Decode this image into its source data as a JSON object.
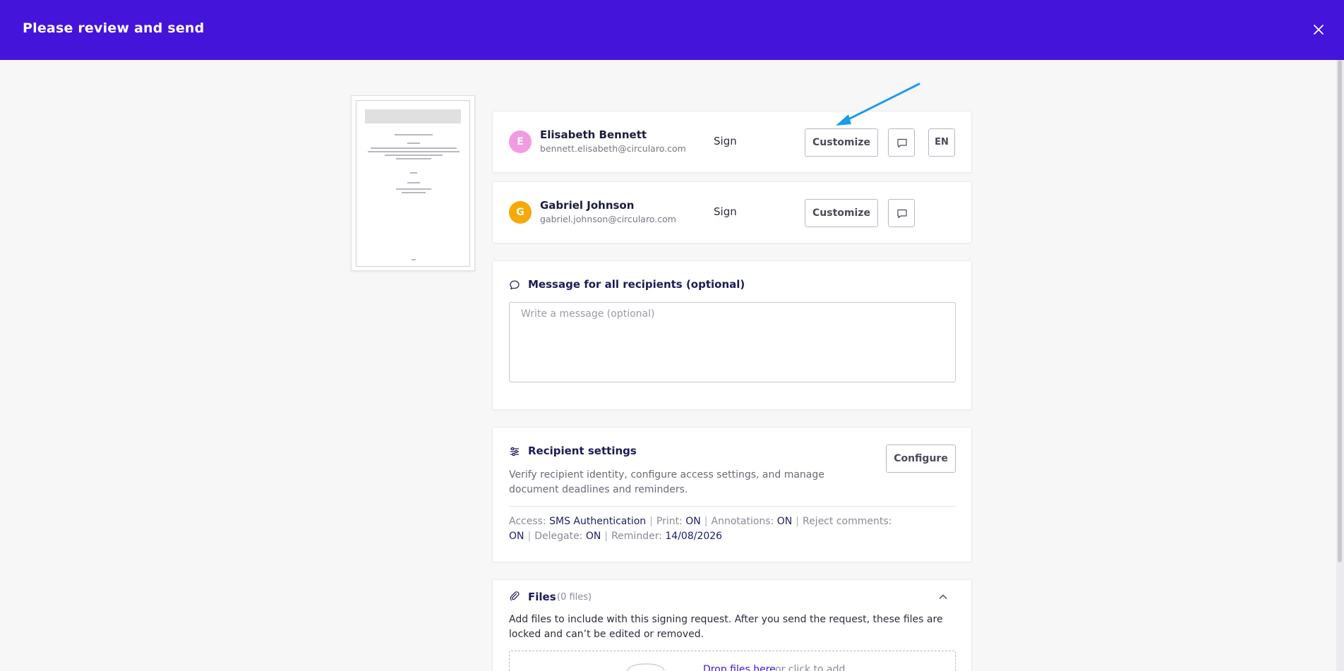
{
  "header": {
    "title": "Please review and send",
    "close_icon": "close-icon"
  },
  "recipients": [
    {
      "initial": "E",
      "avatar_color": "#f39be0",
      "name": "Elisabeth Bennett",
      "email": "bennett.elisabeth@circularo.com",
      "role": "Sign",
      "customize_label": "Customize",
      "language": "EN"
    },
    {
      "initial": "G",
      "avatar_color": "#f5a90a",
      "name": "Gabriel Johnson",
      "email": "gabriel.johnson@circularo.com",
      "role": "Sign",
      "customize_label": "Customize"
    }
  ],
  "message": {
    "title": "Message for all recipients (optional)",
    "placeholder": "Write a message (optional)",
    "value": ""
  },
  "recipient_settings": {
    "title": "Recipient settings",
    "configure_label": "Configure",
    "description": "Verify recipient identity, configure access settings, and manage document deadlines and reminders.",
    "access_label": "Access:",
    "access_value": "SMS Authentication",
    "print_label": "Print:",
    "print_value": "ON",
    "annotations_label": "Annotations:",
    "annotations_value": "ON",
    "reject_label": "Reject comments:",
    "reject_value": "ON",
    "delegate_label": "Delegate:",
    "delegate_value": "ON",
    "reminder_label": "Reminder:",
    "reminder_value": "14/08/2026",
    "separator": "|"
  },
  "files": {
    "title": "Files",
    "count": "(0 files)",
    "description": "Add files to include with this signing request. After you send the request, these files are locked and can’t be edited or removed.",
    "drop_link": "Drop files here",
    "drop_rest": "or click to add"
  },
  "colors": {
    "header_bg": "#4514db",
    "accent": "#4514db",
    "annotation_arrow": "#1a9bf0"
  }
}
